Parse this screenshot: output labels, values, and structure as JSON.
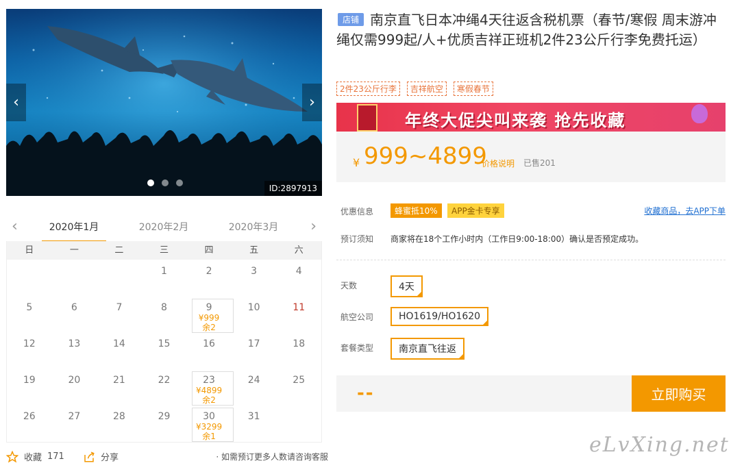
{
  "hero": {
    "id_label": "ID:2897913",
    "prev_symbol": "‹",
    "next_symbol": "›",
    "slide_count": 3,
    "active_slide": 1
  },
  "calendar": {
    "prev_symbol": "‹",
    "next_symbol": "›",
    "months": [
      "2020年1月",
      "2020年2月",
      "2020年3月"
    ],
    "active_month": 0,
    "weekdays": [
      "日",
      "一",
      "二",
      "三",
      "四",
      "五",
      "六"
    ],
    "first_weekday": 3,
    "days_in_month": 31,
    "available": {
      "9": {
        "price": "¥999",
        "stock": "余2"
      },
      "23": {
        "price": "¥4899",
        "stock": "余2"
      },
      "30": {
        "price": "¥3299",
        "stock": "余1"
      }
    },
    "highlight_day": 11
  },
  "bottom": {
    "fav_label": "收藏",
    "fav_count": "171",
    "share_label": "分享",
    "note": "· 如需预订更多人数请咨询客服"
  },
  "product": {
    "shop_tag": "店铺",
    "title": "南京直飞日本冲绳4天往返含税机票（春节/寒假 周末游冲绳仅需999起/人+优质吉祥正班机2件23公斤行李免费托运）",
    "tags": [
      "2件23公斤行李",
      "吉祥航空",
      "寒假春节"
    ],
    "banner_text": "年终大促尖叫来袭  抢先收藏",
    "price": {
      "currency": "¥",
      "value": "999~4899",
      "explain": "价格说明",
      "sold": "已售201"
    },
    "promo": {
      "label": "优惠信息",
      "tag1": "蜂蜜抵10%",
      "tag2": "APP金卡专享",
      "app_link": "收藏商品，去APP下单"
    },
    "notice": {
      "label": "预订须知",
      "text": "商家将在18个工作小时内（工作日9:00-18:00）确认是否预定成功。"
    },
    "options": {
      "days_label": "天数",
      "days_value": "4天",
      "airline_label": "航空公司",
      "airline_value": "HO1619/HO1620",
      "package_label": "套餐类型",
      "package_value": "南京直飞往返"
    },
    "buy": {
      "total": "--",
      "button": "立即购买"
    }
  },
  "watermark": "eLvXing.net",
  "colors": {
    "accent": "#f39800",
    "link": "#1f6fd1",
    "shop_tag": "#6e9be8",
    "banner": "#e8334a"
  }
}
